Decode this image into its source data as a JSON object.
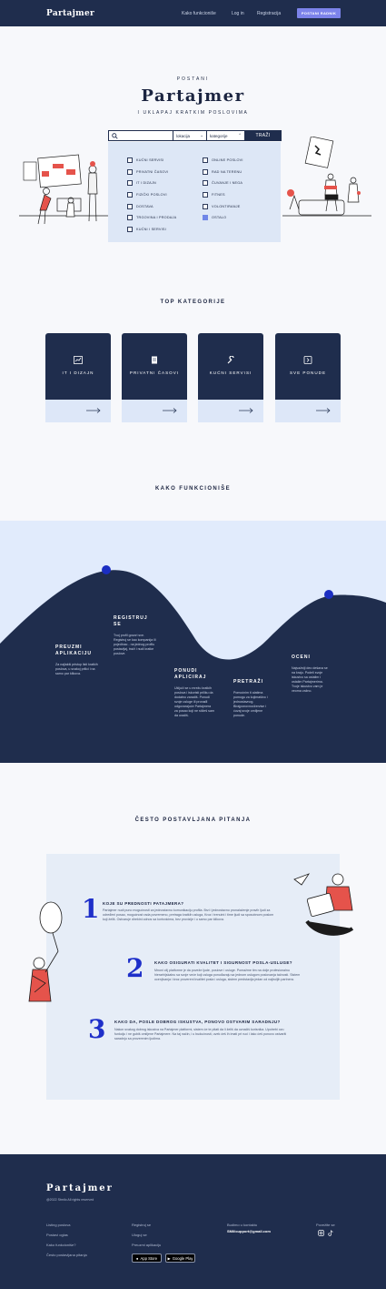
{
  "nav": {
    "logo": "Partajmer",
    "links": [
      "Kako funkcioniše",
      "Log in",
      "Registracija"
    ],
    "cta": "POSTANI RADNIK"
  },
  "hero": {
    "pre": "POSTANI",
    "title": "Partajmer",
    "sub": "I UKLAPAJ KRATKIM POSLOVIMA",
    "search": {
      "select1": "lokacija",
      "select2": "kategorije",
      "button": "TRAŽI"
    },
    "categories_left": [
      {
        "label": "KUĆNI SERVISI",
        "checked": false
      },
      {
        "label": "PRIVATNI ČASOVI",
        "checked": false
      },
      {
        "label": "IT I DIZAJN",
        "checked": false
      },
      {
        "label": "FIZIČKI POSLOVI",
        "checked": false
      },
      {
        "label": "DOSTAVA",
        "checked": false
      },
      {
        "label": "TRGOVINA I PRODAJA",
        "checked": false
      },
      {
        "label": "KUĆNI I SERVISI",
        "checked": false
      }
    ],
    "categories_right": [
      {
        "label": "ONLINE POSLOVI",
        "checked": false
      },
      {
        "label": "RAD NA TERENU",
        "checked": false
      },
      {
        "label": "ČUVANJE I NEGA",
        "checked": false
      },
      {
        "label": "FITNES",
        "checked": false
      },
      {
        "label": "VOLONTIRANJE",
        "checked": false
      },
      {
        "label": "OSTALO",
        "checked": true
      }
    ]
  },
  "top_categories": {
    "title": "TOP KATEGORIJE",
    "cards": [
      {
        "label": "IT I DIZAJN",
        "icon": "chart-icon"
      },
      {
        "label": "PRIVATNI ČASOVI",
        "icon": "document-icon"
      },
      {
        "label": "KUĆNI SERVISI",
        "icon": "wrench-icon"
      },
      {
        "label": "SVE PONUDE",
        "icon": "chevron-right-icon"
      }
    ]
  },
  "how": {
    "title": "KAKO FUNKCIONIŠE",
    "steps": [
      {
        "title": "PREUZMI APLIKACIJU",
        "text": "Za najlakši pristup listi kratkih poslova, u svakoj prilici i na samo par klikova."
      },
      {
        "title": "REGISTRUJ SE",
        "text": "Tvoj profil govori sve. Registruj se kao kompanija ili pojedinac - na jednog profilu postavljaj, traži i nudi kratke poslove."
      },
      {
        "title": "PONUDI APLICIRAJ",
        "text": "Uključi se u mrežu kratkih poslova i iskoristi priliku da dodatno zaradiš. Ponudi svoje usluge ili pronađi odgovarajuće Partajmera za posao koji ne stižeš sam da uradiš."
      },
      {
        "title": "PRETRAŽI",
        "text": "Pomoćnim ti alatima pomogu za kojimaštvo i jednostavnog. Birajponovnoćžervise i ćuvaj svoje omiljene ponude."
      },
      {
        "title": "OCENI",
        "text": "Najvažniji deo dešava se na kraju. Podeli svoje iskustvo sa ostalim i ostalim Partajmerima. Tvoje iskustvo vam je veoma važno."
      }
    ]
  },
  "faq": {
    "title": "ČESTO POSTAVLJANA PITANJA",
    "items": [
      {
        "num": "1",
        "q": "KOJE SU PREDNOSTI PATAJMERA?",
        "a": "Partajmer nudi puno mogućnosti za jednostavnu komunikaciju profila. Brzi i jednostavno pronalaženje pravih ljudi za određeni posao, mogućnost rada povremeno, pretraga kratkih usluga, Kroz i trenutni i time ljudi sa sposobnom poslom koji želiš. Ostvaruje direktni odnos sa korisnicima, bez provizije i u samo par klikova."
      },
      {
        "num": "2",
        "q": "KAKO OSIGURATI KVALITET I SIGURNOST POSLA-USLUGE?",
        "a": "Mnoni cilj platforme je da poveže ljude, poslove i usluge. Pomažme tim na dolje profesionalnu hierarhijskalnu sa svoje veće koji usluga ponuđavaju sa jednom uslugom poslovanja tačnosti. Sistem ocenjivanja i kroz provereni kvalitet posla i usluga, sistem predstavlja jedan od najboljih partnera."
      },
      {
        "num": "3",
        "q": "KAKO DA, POSLE DOBROG ISKUSTVA, PONOVO OSTVARIM SARADNJU?",
        "a": "Nakon svakog dobrog iskustva na Partajmer platformi, sistem će te pitati da li želiš da označiš korisnika. Upotrebi ovu funkciju i ne gubiš omiljene Partajmere. Na taj način, i u budućnosti, uvek ćeš ih imati pri ruci i lako ćeš ponovo ostvariti saradnju sa proverenim ljudima."
      }
    ]
  },
  "footer": {
    "logo": "Partajmer",
    "copy": "@2022 Stmilo All rights reserved",
    "col1": [
      "Listing poslova",
      "Postavi oglas",
      "Kako funkcioniše?",
      "Često postavljana pitanja"
    ],
    "col2": [
      "Registruj se",
      "Uloguj se",
      "Preuzmi aplikaciju"
    ],
    "contact_label": "Budimo u kontaktu",
    "contact_email": "SMilicupport@gmail.com",
    "follow_label": "Povežite se",
    "app_store": "App Store",
    "google_play": "Google Play"
  }
}
